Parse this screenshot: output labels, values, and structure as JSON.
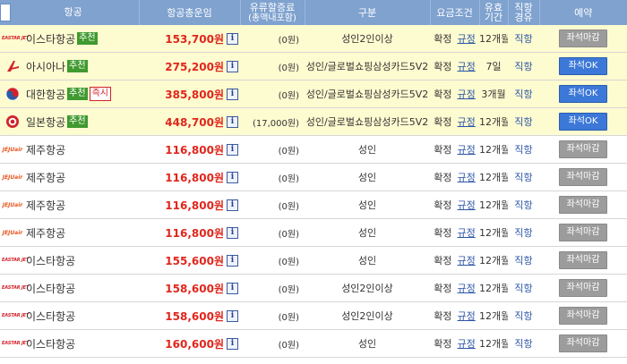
{
  "header": {
    "airline": "항공",
    "total_fare": "항공총운임",
    "fuel_line1": "유류할증료",
    "fuel_line2": "(총액내포함)",
    "type": "구분",
    "condition": "요금조건",
    "valid_line1": "유효",
    "valid_line2": "기간",
    "route_line1": "직항",
    "route_line2": "경유",
    "reserve": "예약"
  },
  "icons": {
    "info": "info-icon"
  },
  "colors": {
    "header_bg": "#7fa2cf",
    "highlight_row": "#fdfbd0",
    "price": "#e0261c",
    "ok_button": "#3c78d8",
    "closed_button": "#9c9c9c",
    "recommend_badge": "#3f9a2f"
  },
  "rows": [
    {
      "airline": "이스타항공",
      "logo": "EASTAR JET",
      "logo_type": "eastar",
      "badges": [
        {
          "text": "추천",
          "kind": "rec"
        }
      ],
      "price": "153,700원",
      "info": "i",
      "fuel": "(0원)",
      "type": "성인2인이상",
      "condition": "확정",
      "rule": "규정",
      "valid": "12개월",
      "route": "직항",
      "button": "좌석마감",
      "button_kind": "closed",
      "highlight": true
    },
    {
      "airline": "아시아나",
      "logo": "",
      "logo_type": "asiana",
      "badges": [
        {
          "text": "추천",
          "kind": "rec"
        }
      ],
      "price": "275,200원",
      "info": "i",
      "fuel": "(0원)",
      "type": "성인/글로벌쇼핑삼성카드5V2",
      "condition": "확정",
      "rule": "규정",
      "valid": "7일",
      "route": "직항",
      "button": "좌석OK",
      "button_kind": "ok",
      "highlight": true
    },
    {
      "airline": "대한항공",
      "logo": "",
      "logo_type": "korean",
      "badges": [
        {
          "text": "추천",
          "kind": "rec"
        },
        {
          "text": "즉시",
          "kind": "inst"
        }
      ],
      "price": "385,800원",
      "info": "i",
      "fuel": "(0원)",
      "type": "성인/글로벌쇼핑삼성카드5V2",
      "condition": "확정",
      "rule": "규정",
      "valid": "3개월",
      "route": "직항",
      "button": "좌석OK",
      "button_kind": "ok",
      "highlight": true
    },
    {
      "airline": "일본항공",
      "logo": "",
      "logo_type": "jal",
      "badges": [
        {
          "text": "추천",
          "kind": "rec"
        }
      ],
      "price": "448,700원",
      "info": "i",
      "fuel": "(17,000원)",
      "type": "성인/글로벌쇼핑삼성카드5V2",
      "condition": "확정",
      "rule": "규정",
      "valid": "12개월",
      "route": "직항",
      "button": "좌석OK",
      "button_kind": "ok",
      "highlight": true
    },
    {
      "airline": "제주항공",
      "logo": "JEJUair",
      "logo_type": "jeju",
      "badges": [],
      "price": "116,800원",
      "info": "i",
      "fuel": "(0원)",
      "type": "성인",
      "condition": "확정",
      "rule": "규정",
      "valid": "12개월",
      "route": "직항",
      "button": "좌석마감",
      "button_kind": "closed",
      "highlight": false
    },
    {
      "airline": "제주항공",
      "logo": "JEJUair",
      "logo_type": "jeju",
      "badges": [],
      "price": "116,800원",
      "info": "i",
      "fuel": "(0원)",
      "type": "성인",
      "condition": "확정",
      "rule": "규정",
      "valid": "12개월",
      "route": "직항",
      "button": "좌석마감",
      "button_kind": "closed",
      "highlight": false
    },
    {
      "airline": "제주항공",
      "logo": "JEJUair",
      "logo_type": "jeju",
      "badges": [],
      "price": "116,800원",
      "info": "i",
      "fuel": "(0원)",
      "type": "성인",
      "condition": "확정",
      "rule": "규정",
      "valid": "12개월",
      "route": "직항",
      "button": "좌석마감",
      "button_kind": "closed",
      "highlight": false
    },
    {
      "airline": "제주항공",
      "logo": "JEJUair",
      "logo_type": "jeju",
      "badges": [],
      "price": "116,800원",
      "info": "i",
      "fuel": "(0원)",
      "type": "성인",
      "condition": "확정",
      "rule": "규정",
      "valid": "12개월",
      "route": "직항",
      "button": "좌석마감",
      "button_kind": "closed",
      "highlight": false
    },
    {
      "airline": "이스타항공",
      "logo": "EASTAR JET",
      "logo_type": "eastar",
      "badges": [],
      "price": "155,600원",
      "info": "i",
      "fuel": "(0원)",
      "type": "성인",
      "condition": "확정",
      "rule": "규정",
      "valid": "12개월",
      "route": "직항",
      "button": "좌석마감",
      "button_kind": "closed",
      "highlight": false
    },
    {
      "airline": "이스타항공",
      "logo": "EASTAR JET",
      "logo_type": "eastar",
      "badges": [],
      "price": "158,600원",
      "info": "i",
      "fuel": "(0원)",
      "type": "성인2인이상",
      "condition": "확정",
      "rule": "규정",
      "valid": "12개월",
      "route": "직항",
      "button": "좌석마감",
      "button_kind": "closed",
      "highlight": false
    },
    {
      "airline": "이스타항공",
      "logo": "EASTAR JET",
      "logo_type": "eastar",
      "badges": [],
      "price": "158,600원",
      "info": "i",
      "fuel": "(0원)",
      "type": "성인2인이상",
      "condition": "확정",
      "rule": "규정",
      "valid": "12개월",
      "route": "직항",
      "button": "좌석마감",
      "button_kind": "closed",
      "highlight": false
    },
    {
      "airline": "이스타항공",
      "logo": "EASTAR JET",
      "logo_type": "eastar",
      "badges": [],
      "price": "160,600원",
      "info": "i",
      "fuel": "(0원)",
      "type": "성인",
      "condition": "확정",
      "rule": "규정",
      "valid": "12개월",
      "route": "직항",
      "button": "좌석마감",
      "button_kind": "closed",
      "highlight": false
    }
  ]
}
